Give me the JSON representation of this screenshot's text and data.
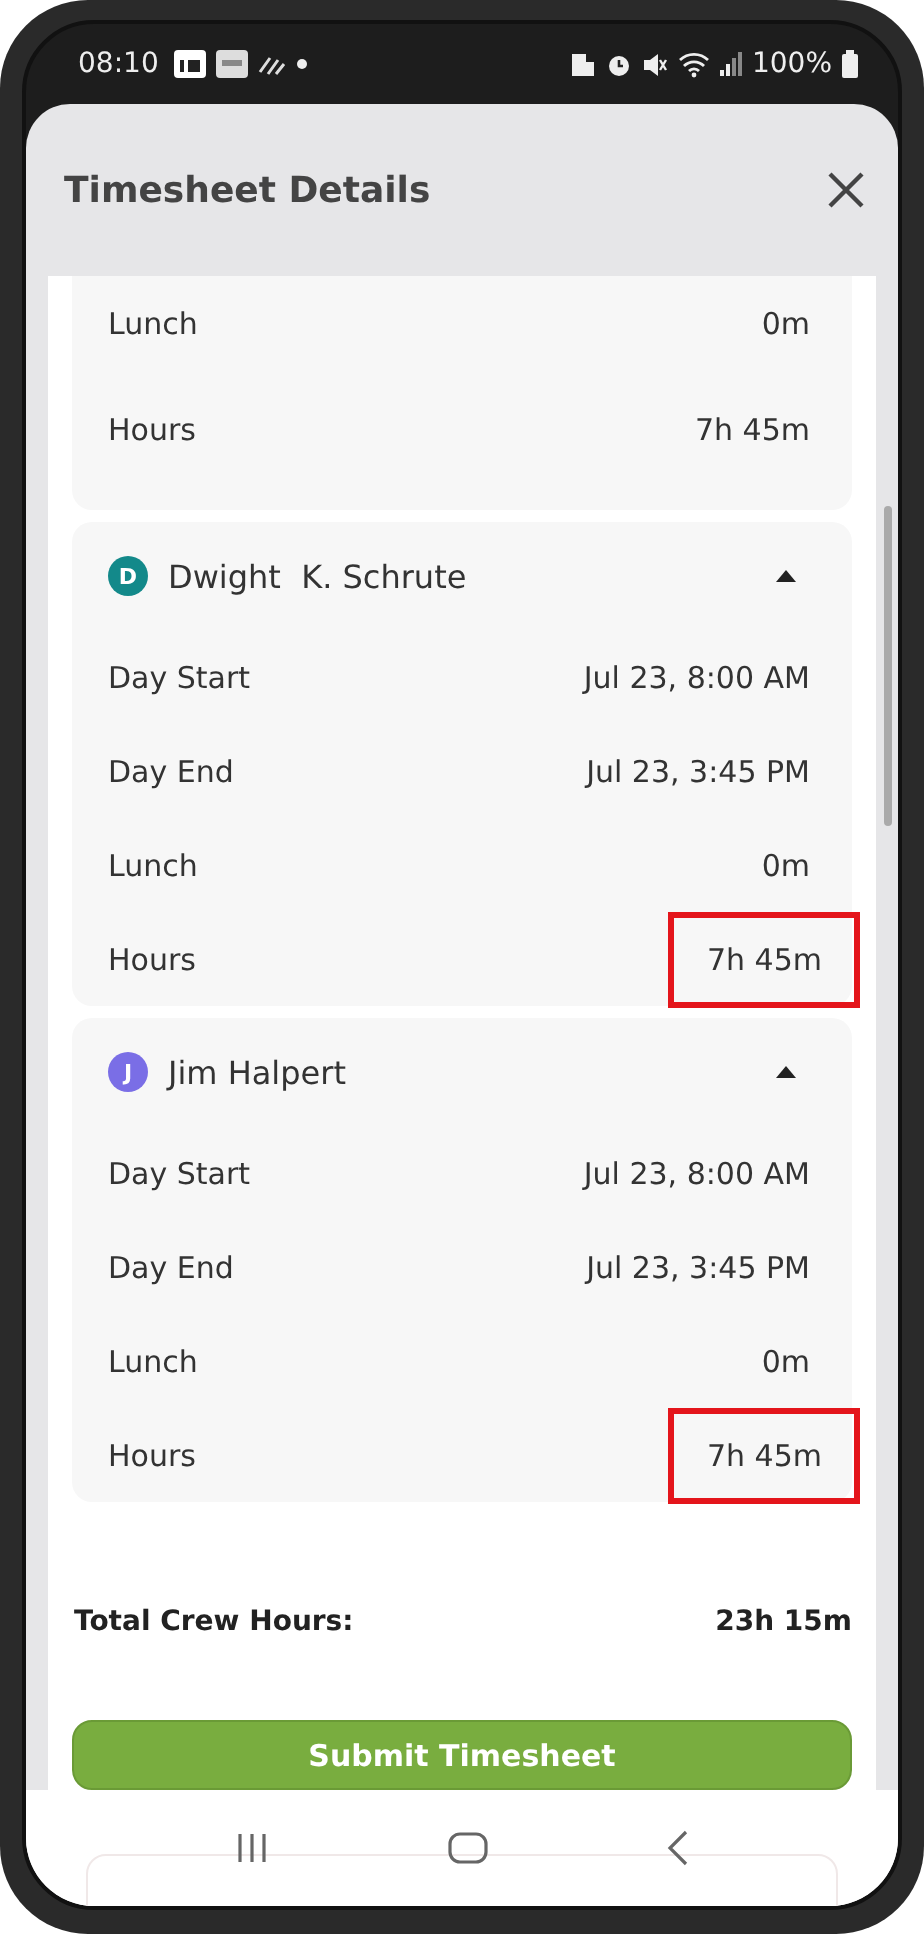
{
  "status_bar": {
    "time": "08:10",
    "battery": "100%"
  },
  "sheet": {
    "title": "Timesheet Details"
  },
  "cards": [
    {
      "partial": true,
      "rows": [
        {
          "label": "Lunch",
          "value": "0m",
          "highlighted": false
        },
        {
          "label": "Hours",
          "value": "7h 45m",
          "highlighted": false
        }
      ]
    },
    {
      "partial": false,
      "initial": "D",
      "color": "#13898a",
      "name": "Dwight  K. Schrute",
      "expanded": true,
      "rows": [
        {
          "label": "Day Start",
          "value": "Jul 23, 8:00 AM",
          "highlighted": false
        },
        {
          "label": "Day End",
          "value": "Jul 23, 3:45 PM",
          "highlighted": false
        },
        {
          "label": "Lunch",
          "value": "0m",
          "highlighted": false
        },
        {
          "label": "Hours",
          "value": "7h 45m",
          "highlighted": true
        }
      ]
    },
    {
      "partial": false,
      "initial": "J",
      "color": "#7a6ee6",
      "name": "Jim Halpert",
      "expanded": true,
      "rows": [
        {
          "label": "Day Start",
          "value": "Jul 23, 8:00 AM",
          "highlighted": false
        },
        {
          "label": "Day End",
          "value": "Jul 23, 3:45 PM",
          "highlighted": false
        },
        {
          "label": "Lunch",
          "value": "0m",
          "highlighted": false
        },
        {
          "label": "Hours",
          "value": "7h 45m",
          "highlighted": true
        }
      ]
    }
  ],
  "total": {
    "label": "Total Crew Hours:",
    "value": "23h 15m"
  },
  "submit_button": "Submit Timesheet"
}
